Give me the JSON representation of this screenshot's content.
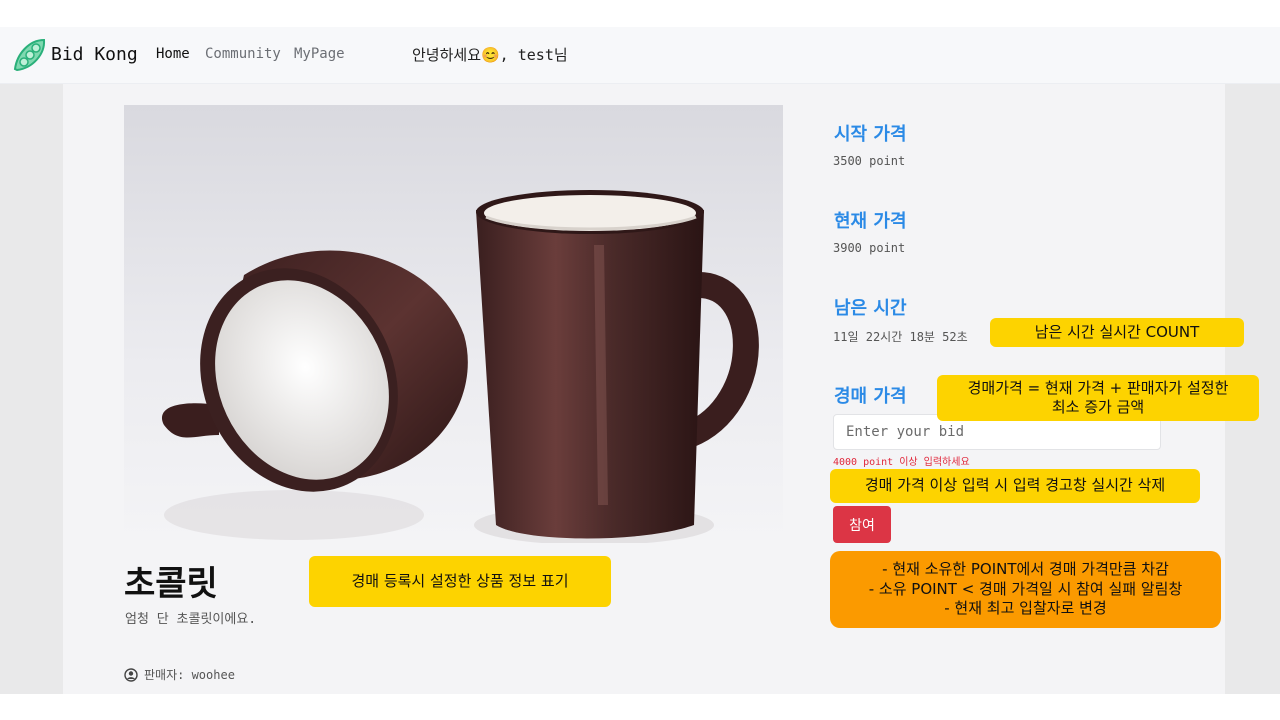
{
  "nav": {
    "brand": "Bid Kong",
    "links": [
      "Home",
      "Community",
      "MyPage"
    ],
    "greeting": "안녕하세요😊, test님"
  },
  "product": {
    "title": "초콜릿",
    "description": "엄청 단 초콜릿이에요.",
    "seller_label": "판매자: woohee"
  },
  "auction": {
    "start_price_title": "시작 가격",
    "start_price_value": "3500 point",
    "current_price_title": "현재 가격",
    "current_price_value": "3900 point",
    "remaining_title": "남은 시간",
    "remaining_value": "11일 22시간 18분 52초",
    "bid_title": "경매 가격",
    "bid_placeholder": "Enter your bid",
    "bid_warning": "4000 point 이상 입력하세요",
    "join_label": "참여"
  },
  "annotations": {
    "countdown": "남은 시간 실시간 COUNT",
    "bid_price_line1": "경매가격 = 현재 가격 + 판매자가 설정한",
    "bid_price_line2": "최소 증가 금액",
    "warning_remove": "경매 가격 이상 입력 시 입력 경고창 실시간 삭제",
    "product_info": "경매 등록시 설정한 상품 정보 표기",
    "join_line1": "- 현재 소유한 POINT에서 경매 가격만큼 차감",
    "join_line2": "- 소유 POINT < 경매 가격일 시 참여 실패 알림창",
    "join_line3": "- 현재 최고 입찰자로 변경"
  },
  "colors": {
    "accent": "#2b8ae6",
    "danger": "#dc3545",
    "note_yellow": "#fdd300",
    "note_orange": "#fb9a00"
  }
}
